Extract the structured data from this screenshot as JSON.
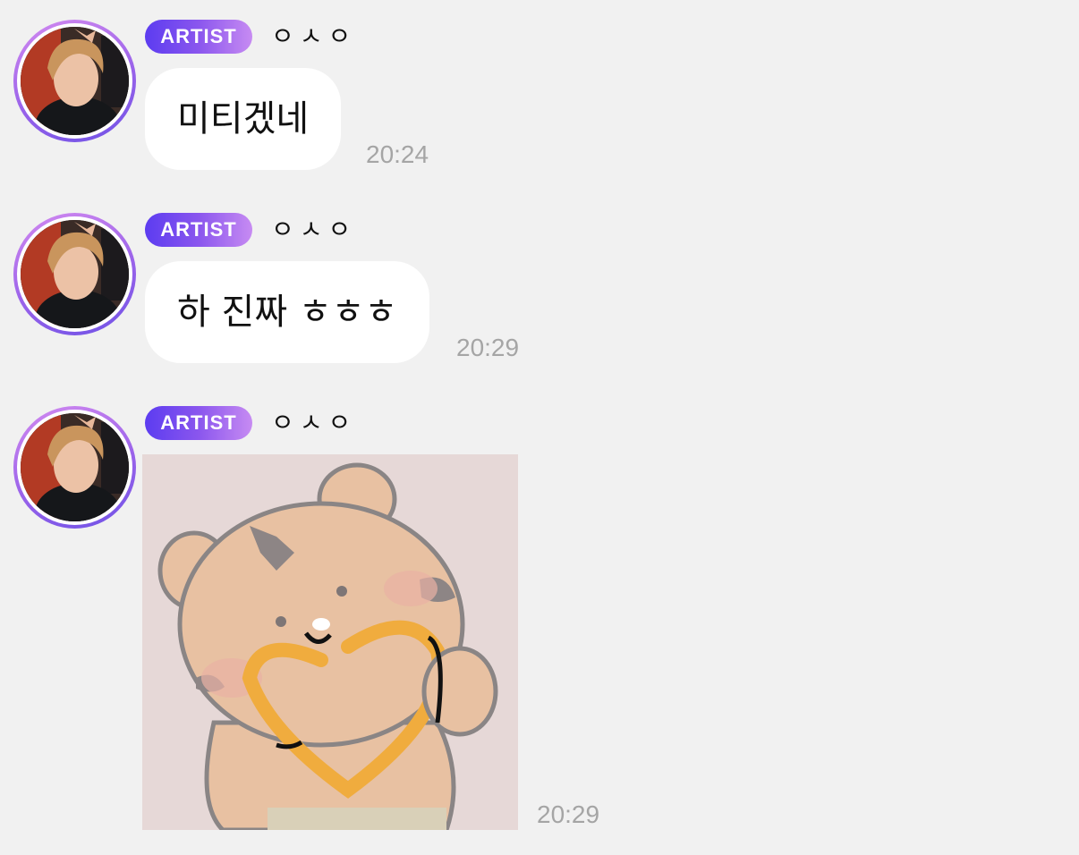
{
  "messages": [
    {
      "badge": "ARTIST",
      "sender": "ㅇㅅㅇ",
      "text": "미티겠네",
      "time": "20:24",
      "type": "text"
    },
    {
      "badge": "ARTIST",
      "sender": "ㅇㅅㅇ",
      "text": "하 진짜 ㅎㅎㅎ",
      "time": "20:29",
      "type": "text"
    },
    {
      "badge": "ARTIST",
      "sender": "ㅇㅅㅇ",
      "sticker": "tiger-heart-sticker",
      "time": "20:29",
      "type": "sticker"
    }
  ],
  "colors": {
    "background": "#f1f1f1",
    "bubble": "#ffffff",
    "badge_start": "#5c3cf0",
    "badge_end": "#c78bf2",
    "timestamp": "#a5a5a5",
    "sticker_bg": "#e6d8d7"
  }
}
